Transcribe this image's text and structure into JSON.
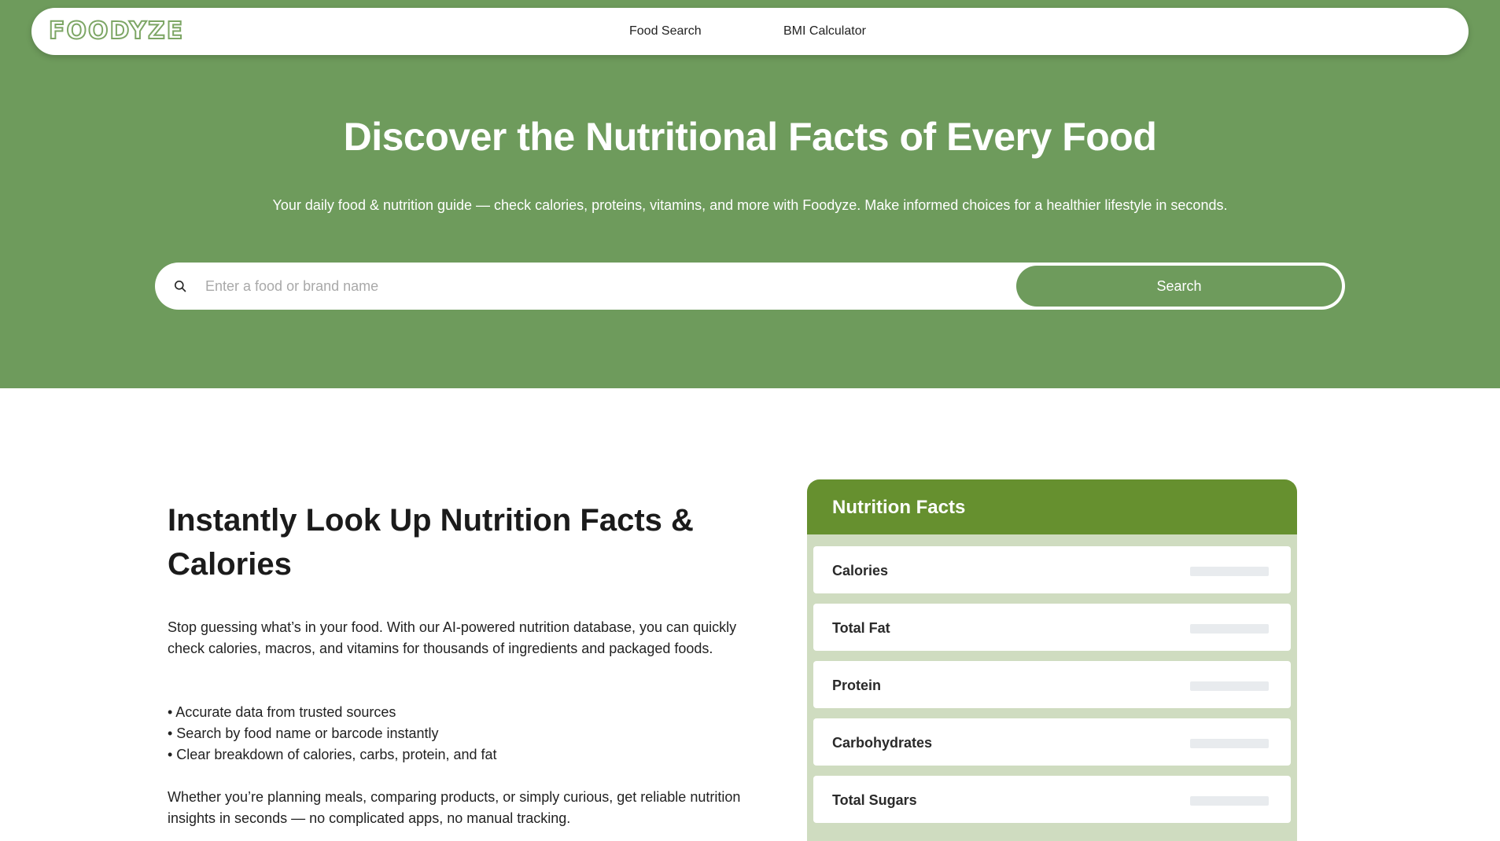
{
  "brand": {
    "logo": "FOODYZE",
    "accent_color": "#6e9b5c",
    "card_header_color": "#66902f",
    "card_body_color": "#cfdcc0"
  },
  "nav": {
    "items": [
      {
        "label": "Food Search"
      },
      {
        "label": "BMI Calculator"
      }
    ]
  },
  "hero": {
    "title": "Discover the Nutritional Facts of Every Food",
    "subtitle": "Your daily food & nutrition guide — check calories, proteins, vitamins, and more with Foodyze. Make informed choices for a healthier lifestyle in seconds.",
    "search": {
      "icon": "search-icon",
      "placeholder": "Enter a food or brand name",
      "value": "",
      "button_label": "Search"
    }
  },
  "intro": {
    "title": "Instantly Look Up Nutrition Facts & Calories",
    "paragraph1": "Stop guessing what’s in your food. With our AI-powered nutrition database, you can quickly check calories, macros, and vitamins for thousands of ingredients and packaged foods.",
    "bullets": [
      "• Accurate data from trusted sources",
      "• Search by food name or barcode instantly",
      "• Clear breakdown of calories, carbs, protein, and fat"
    ],
    "paragraph2": "Whether you’re planning meals, comparing products, or simply curious, get reliable nutrition insights in seconds — no complicated apps, no manual tracking."
  },
  "nutrition_card": {
    "title": "Nutrition Facts",
    "rows": [
      {
        "label": "Calories"
      },
      {
        "label": "Total Fat"
      },
      {
        "label": "Protein"
      },
      {
        "label": "Carbohydrates"
      },
      {
        "label": "Total Sugars"
      }
    ]
  }
}
